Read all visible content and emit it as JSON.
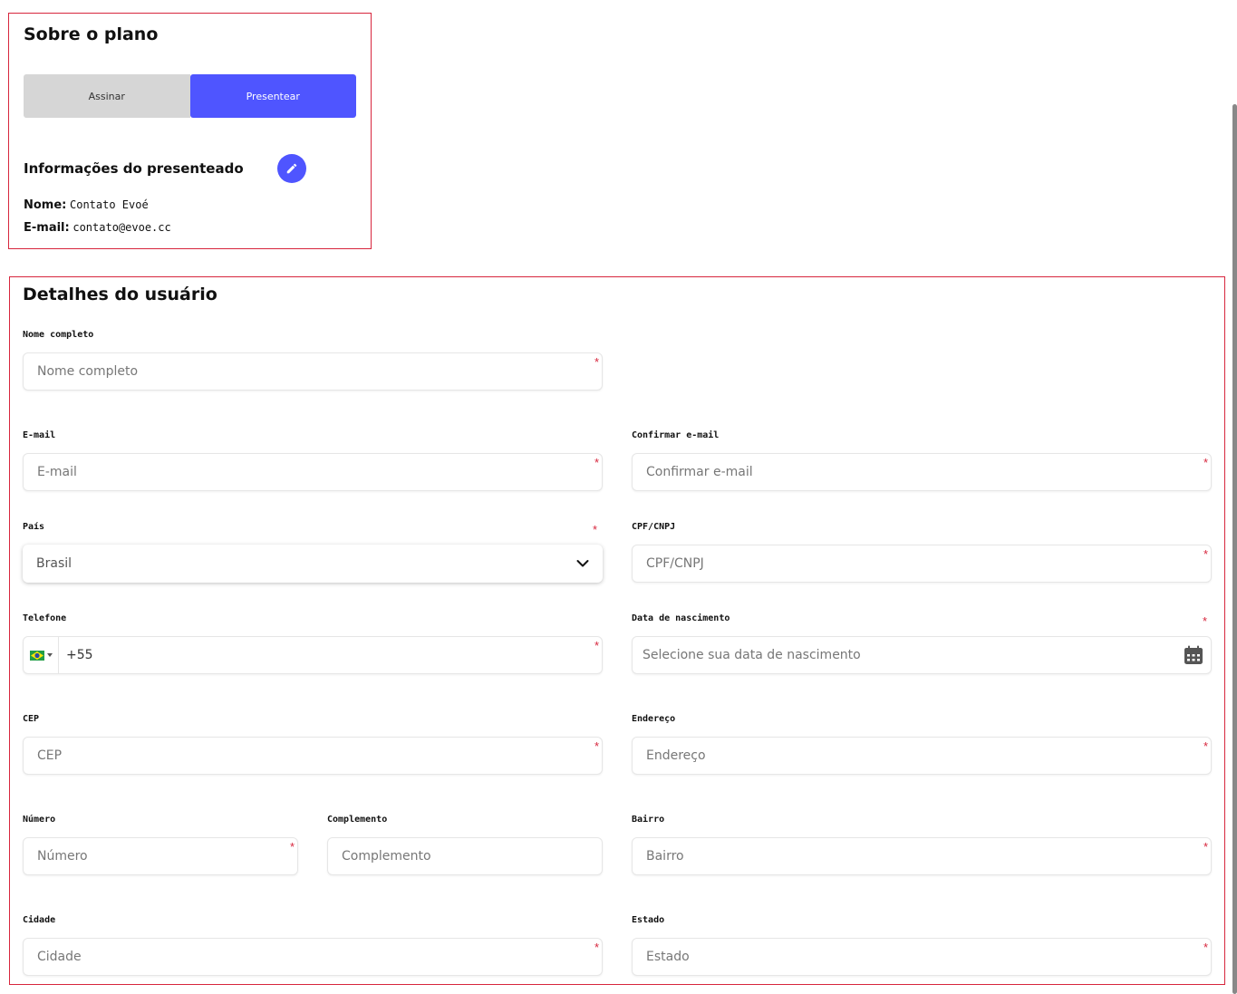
{
  "plan": {
    "title": "Sobre o plano",
    "toggle": {
      "subscribe": "Assinar",
      "gift": "Presentear",
      "selected": "Presentear"
    },
    "info_title": "Informações do presenteado",
    "name_label": "Nome:",
    "name_value": "Contato Evoé",
    "email_label": "E-mail:",
    "email_value": "contato@evoe.cc"
  },
  "user": {
    "title": "Detalhes do usuário",
    "fields": {
      "full_name": {
        "label": "Nome completo",
        "placeholder": "Nome completo"
      },
      "email": {
        "label": "E-mail",
        "placeholder": "E-mail"
      },
      "confirm_email": {
        "label": "Confirmar e-mail",
        "placeholder": "Confirmar e-mail"
      },
      "country": {
        "label": "País",
        "value": "Brasil"
      },
      "cpf": {
        "label": "CPF/CNPJ",
        "placeholder": "CPF/CNPJ"
      },
      "phone": {
        "label": "Telefone",
        "value": "+55"
      },
      "birthdate": {
        "label": "Data de nascimento",
        "placeholder": "Selecione sua data de nascimento"
      },
      "cep": {
        "label": "CEP",
        "placeholder": "CEP"
      },
      "address": {
        "label": "Endereço",
        "placeholder": "Endereço"
      },
      "number": {
        "label": "Número",
        "placeholder": "Número"
      },
      "complement": {
        "label": "Complemento",
        "placeholder": "Complemento"
      },
      "district": {
        "label": "Bairro",
        "placeholder": "Bairro"
      },
      "city": {
        "label": "Cidade",
        "placeholder": "Cidade"
      },
      "state": {
        "label": "Estado",
        "placeholder": "Estado"
      }
    },
    "required_mark": "*"
  },
  "colors": {
    "accent": "#4f55ff",
    "border": "#d7263d",
    "required": "#d7263d"
  },
  "icons": {
    "edit": "pencil-icon",
    "calendar": "calendar-icon",
    "dropdown": "chevron-down-icon",
    "flag": "brazil-flag-icon"
  }
}
